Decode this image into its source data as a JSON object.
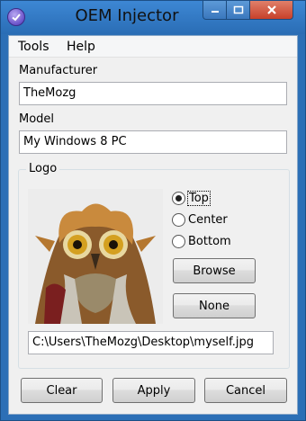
{
  "window": {
    "title": "OEM Injector"
  },
  "menu": {
    "tools": "Tools",
    "help": "Help"
  },
  "fields": {
    "manufacturer_label": "Manufacturer",
    "manufacturer_value": "TheMozg",
    "model_label": "Model",
    "model_value": "My Windows 8 PC"
  },
  "logo": {
    "group_label": "Logo",
    "options": [
      "Top",
      "Center",
      "Bottom"
    ],
    "selected_option": "Top",
    "browse_label": "Browse",
    "none_label": "None",
    "path": "C:\\Users\\TheMozg\\Desktop\\myself.jpg"
  },
  "buttons": {
    "clear": "Clear",
    "apply": "Apply",
    "cancel": "Cancel"
  }
}
